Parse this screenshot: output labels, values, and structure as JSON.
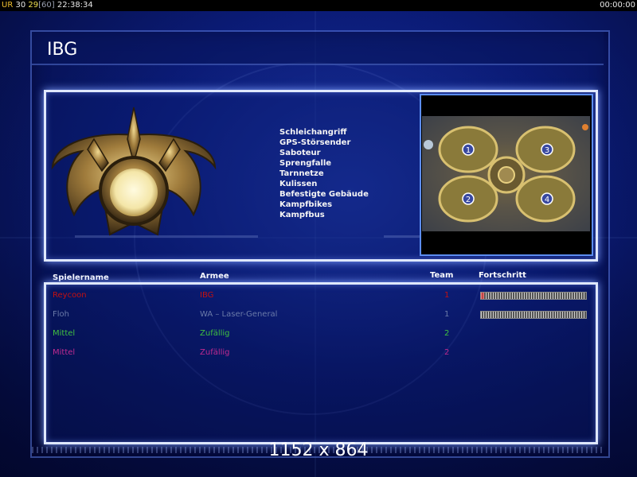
{
  "topbar": {
    "label": "UR",
    "value_a": "30",
    "value_b": "29",
    "value_c": "60",
    "clock": "22:38:34",
    "timer": "00:00:00"
  },
  "title": "IBG",
  "upgrades": [
    "Schleichangriff",
    "GPS-Störsender",
    "Saboteur",
    "Sprengfalle",
    "Tarnnetze",
    "Kulissen",
    "Befestigte Gebäude",
    "Kampfbikes",
    "Kampfbus"
  ],
  "minimap": {
    "start_labels": [
      "1",
      "2",
      "3",
      "4"
    ]
  },
  "table_headers": {
    "player": "Spielername",
    "army": "Armee",
    "team": "Team",
    "progress": "Fortschritt"
  },
  "players": [
    {
      "name": "Reycoon",
      "army": "IBG",
      "team": "1",
      "color": "#c41010",
      "progress": 0.03
    },
    {
      "name": "Floh",
      "army": "WA – Laser-General",
      "team": "1",
      "color": "#6a7aa8",
      "progress": 0.0
    },
    {
      "name": "Mittel",
      "army": "Zufällig",
      "team": "2",
      "color": "#40c040"
    },
    {
      "name": "Mittel",
      "army": "Zufällig",
      "team": "2",
      "color": "#c02a90"
    }
  ],
  "resolution": "1152 x 864",
  "colors": {
    "accent_frame": "#dfe8ff",
    "map_border": "#5c8df0",
    "background": "#06114a"
  }
}
